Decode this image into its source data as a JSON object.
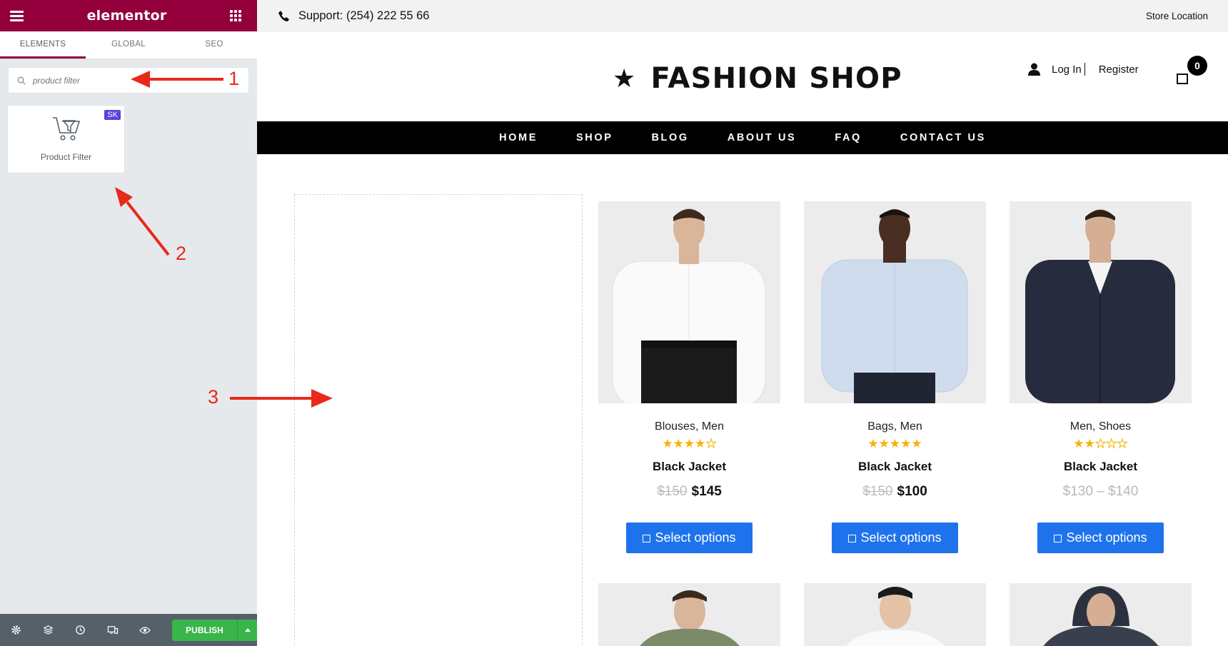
{
  "sidebar": {
    "logo": "elementor",
    "tabs": [
      "ELEMENTS",
      "GLOBAL",
      "SEO"
    ],
    "search": {
      "placeholder": "product filter"
    },
    "widget": {
      "label": "Product Filter",
      "badge": "SK"
    },
    "footer": {
      "publish_label": "PUBLISH"
    },
    "colors": {
      "header": "#93003c",
      "publish": "#39b54a",
      "badge": "#5b40dd"
    }
  },
  "site": {
    "support": "Support: (254) 222 55 66",
    "store_location": "Store Location",
    "brand": "FASHION SHOP",
    "login": "Log In",
    "register": "Register",
    "cart_count": "0",
    "nav": [
      "HOME",
      "SHOP",
      "BLOG",
      "ABOUT US",
      "FAQ",
      "CONTACT US"
    ],
    "products": [
      {
        "categories": "Blouses, Men",
        "rating": 4,
        "name": "Black Jacket",
        "old_price": "$150",
        "price": "$145",
        "button": "Select options",
        "shirt": "white"
      },
      {
        "categories": "Bags, Men",
        "rating": 5,
        "name": "Black Jacket",
        "old_price": "$150",
        "price": "$100",
        "button": "Select options",
        "shirt": "light-blue"
      },
      {
        "categories": "Men, Shoes",
        "rating": 2,
        "name": "Black Jacket",
        "old_price": "",
        "price": "$130 – $140",
        "button": "Select options",
        "shirt": "navy-cardigan"
      }
    ],
    "colors": {
      "button": "#1e73ec",
      "star": "#f5b301",
      "nav_bg": "#000000"
    }
  },
  "annotations": [
    "1",
    "2",
    "3"
  ]
}
